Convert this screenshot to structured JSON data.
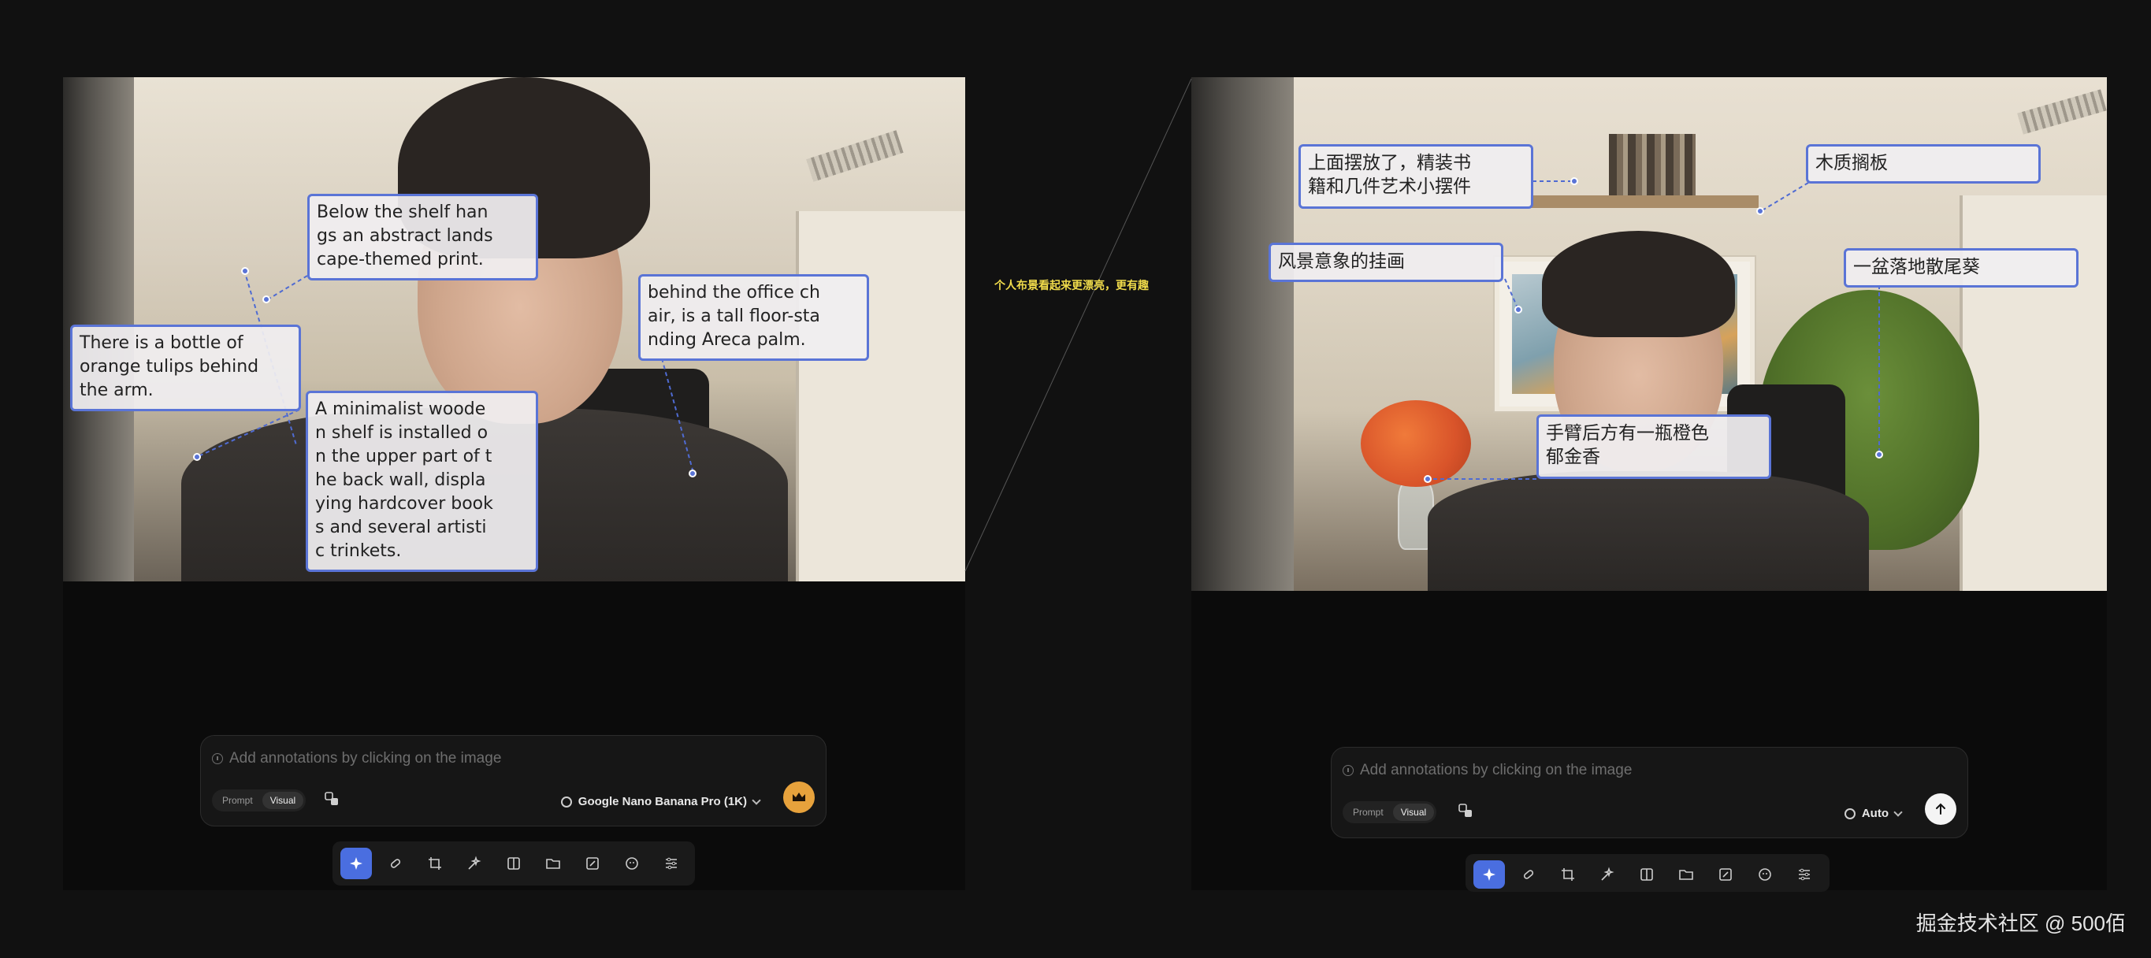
{
  "center_caption": "个人布景看起来更漂亮，更有趣",
  "watermark": "掘金技术社区 @ 500佰",
  "left_panel": {
    "annotations": [
      {
        "text": "Below the shelf han\ngs an abstract lands\ncape-themed print."
      },
      {
        "text": "behind the office ch\nair, is a tall floor-sta\nnding Areca palm."
      },
      {
        "text": "There is a bottle of\norange tulips behind\n the arm."
      },
      {
        "text": "A minimalist woode\nn shelf is installed o\nn the upper part of t\nhe back wall, displa\nying hardcover book\ns and several artisti\nc trinkets."
      }
    ],
    "prompt": {
      "placeholder": "Add annotations by clicking on the image",
      "mode_prompt": "Prompt",
      "mode_visual": "Visual",
      "model": "Google Nano Banana Pro (1K)"
    }
  },
  "right_panel": {
    "annotations": [
      {
        "text": "上面摆放了，精装书\n籍和几件艺术小摆件"
      },
      {
        "text": "木质搁板"
      },
      {
        "text": "风景意象的挂画"
      },
      {
        "text": "一盆落地散尾葵"
      },
      {
        "text": "手臂后方有一瓶橙色\n郁金香"
      }
    ],
    "prompt": {
      "placeholder": "Add annotations by clicking on the image",
      "mode_prompt": "Prompt",
      "mode_visual": "Visual",
      "model": "Auto"
    }
  },
  "toolbar_tools": [
    "sparkle-icon",
    "eraser-icon",
    "crop-icon",
    "magic-wand-icon",
    "compare-icon",
    "folder-icon",
    "expand-icon",
    "face-icon",
    "sliders-icon"
  ],
  "colors": {
    "accent": "#4a6ee0",
    "annotation_border": "#5a74d6",
    "caption": "#f1dc4b",
    "send_crown": "#e7a23c"
  }
}
